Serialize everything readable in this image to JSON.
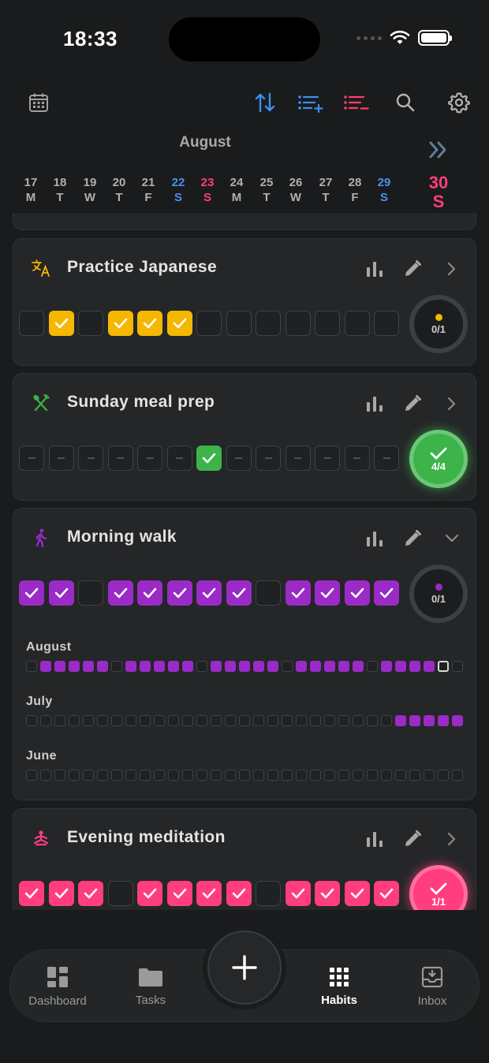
{
  "status": {
    "time": "18:33"
  },
  "toolbar": {
    "icons": [
      "calendar-icon",
      "sort-icon",
      "add-list-icon",
      "remove-list-icon",
      "search-icon",
      "settings-icon"
    ],
    "accent_blue": "#3d8ef5",
    "accent_red": "#ff3d6a"
  },
  "calendar": {
    "month": "August",
    "days": [
      {
        "num": "17",
        "dow": "M",
        "kind": "normal"
      },
      {
        "num": "18",
        "dow": "T",
        "kind": "normal"
      },
      {
        "num": "19",
        "dow": "W",
        "kind": "normal"
      },
      {
        "num": "20",
        "dow": "T",
        "kind": "normal"
      },
      {
        "num": "21",
        "dow": "F",
        "kind": "normal"
      },
      {
        "num": "22",
        "dow": "S",
        "kind": "sat"
      },
      {
        "num": "23",
        "dow": "S",
        "kind": "sun"
      },
      {
        "num": "24",
        "dow": "M",
        "kind": "normal"
      },
      {
        "num": "25",
        "dow": "T",
        "kind": "normal"
      },
      {
        "num": "26",
        "dow": "W",
        "kind": "normal"
      },
      {
        "num": "27",
        "dow": "T",
        "kind": "normal"
      },
      {
        "num": "28",
        "dow": "F",
        "kind": "normal"
      },
      {
        "num": "29",
        "dow": "S",
        "kind": "sat"
      },
      {
        "num": "30",
        "dow": "S",
        "kind": "today"
      }
    ]
  },
  "habits": [
    {
      "name": "Practice Japanese",
      "icon": "translate-icon",
      "color": "#f5b800",
      "days": [
        "off",
        "on",
        "off",
        "on",
        "on",
        "on",
        "off",
        "off",
        "off",
        "off",
        "off",
        "off",
        "off"
      ],
      "progress": "0/1",
      "done": false,
      "expanded": false
    },
    {
      "name": "Sunday meal prep",
      "icon": "utensils-icon",
      "color": "#3cb44a",
      "days": [
        "dash",
        "dash",
        "dash",
        "dash",
        "dash",
        "dash",
        "on",
        "dash",
        "dash",
        "dash",
        "dash",
        "dash",
        "dash"
      ],
      "progress": "4/4",
      "done": true,
      "expanded": false
    },
    {
      "name": "Morning walk",
      "icon": "walking-icon",
      "color": "#9a2bc6",
      "days": [
        "on",
        "on",
        "off",
        "on",
        "on",
        "on",
        "on",
        "on",
        "off",
        "on",
        "on",
        "on",
        "on"
      ],
      "progress": "0/1",
      "done": false,
      "expanded": true,
      "months": [
        {
          "label": "August",
          "cells": [
            0,
            1,
            1,
            1,
            1,
            1,
            0,
            1,
            1,
            1,
            1,
            1,
            0,
            1,
            1,
            1,
            1,
            1,
            0,
            1,
            1,
            1,
            1,
            1,
            0,
            1,
            1,
            1,
            1,
            2,
            0
          ]
        },
        {
          "label": "July",
          "cells": [
            0,
            0,
            0,
            0,
            0,
            0,
            0,
            0,
            0,
            0,
            0,
            0,
            0,
            0,
            0,
            0,
            0,
            0,
            0,
            0,
            0,
            0,
            0,
            0,
            0,
            0,
            1,
            1,
            1,
            1,
            1
          ]
        },
        {
          "label": "June",
          "cells": [
            0,
            0,
            0,
            0,
            0,
            0,
            0,
            0,
            0,
            0,
            0,
            0,
            0,
            0,
            0,
            0,
            0,
            0,
            0,
            0,
            0,
            0,
            0,
            0,
            0,
            0,
            0,
            0,
            0,
            0,
            0
          ]
        }
      ]
    },
    {
      "name": "Evening meditation",
      "icon": "meditation-icon",
      "color": "#ff3d7f",
      "days": [
        "on",
        "on",
        "on",
        "off",
        "on",
        "on",
        "on",
        "on",
        "off",
        "on",
        "on",
        "on",
        "on"
      ],
      "progress": "1/1",
      "done": true,
      "expanded": false
    }
  ],
  "nav": {
    "items": [
      {
        "label": "Dashboard",
        "icon": "dashboard-icon",
        "active": false
      },
      {
        "label": "Tasks",
        "icon": "folder-icon",
        "active": false
      },
      {
        "label": "Habits",
        "icon": "grid-icon",
        "active": true
      },
      {
        "label": "Inbox",
        "icon": "inbox-icon",
        "active": false
      }
    ],
    "add_icon": "plus-icon"
  }
}
